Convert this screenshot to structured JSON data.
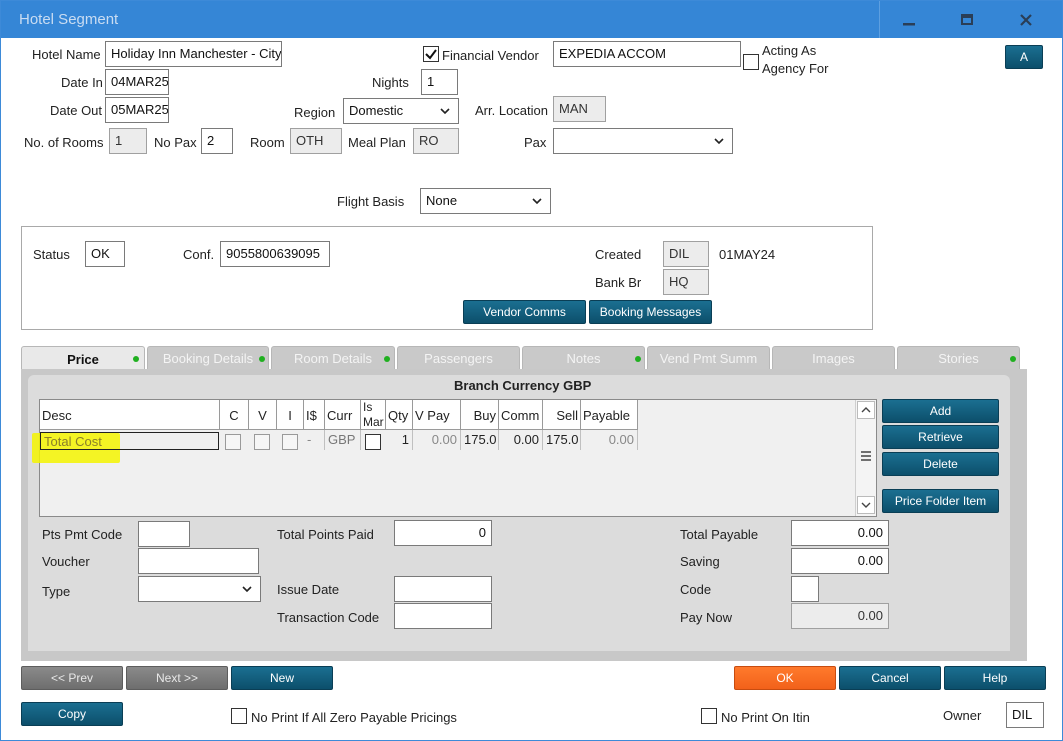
{
  "window": {
    "title": "Hotel Segment",
    "corner_button": "A"
  },
  "header": {
    "hotel_name_label": "Hotel Name",
    "hotel_name": "Holiday Inn Manchester - City",
    "financial_vendor_label": "Financial Vendor",
    "financial_vendor_checked": true,
    "vendor": "EXPEDIA ACCOM",
    "acting_as_label": "Acting As",
    "agency_for_label": "Agency For",
    "date_in_label": "Date In",
    "date_in": "04MAR25",
    "nights_label": "Nights",
    "nights": "1",
    "date_out_label": "Date Out",
    "date_out": "05MAR25",
    "region_label": "Region",
    "region": "Domestic",
    "arr_location_label": "Arr. Location",
    "arr_location": "MAN",
    "rooms_label": "No. of Rooms",
    "rooms": "1",
    "pax_count_label": "No Pax",
    "pax_count": "2",
    "room_label": "Room",
    "room": "OTH",
    "meal_plan_label": "Meal Plan",
    "meal_plan": "RO",
    "pax_label": "Pax",
    "pax": "",
    "flight_basis_label": "Flight Basis",
    "flight_basis": "None"
  },
  "status_box": {
    "status_label": "Status",
    "status": "OK",
    "conf_label": "Conf.",
    "conf": "9055800639095",
    "created_label": "Created",
    "created_by": "DIL",
    "created_date": "01MAY24",
    "bank_br_label": "Bank Br",
    "bank_br": "HQ",
    "vendor_comms": "Vendor Comms",
    "booking_messages": "Booking Messages"
  },
  "tabs": [
    {
      "label": "Price",
      "dot": true
    },
    {
      "label": "Booking Details",
      "dot": true
    },
    {
      "label": "Room Details",
      "dot": true
    },
    {
      "label": "Passengers",
      "dot": false
    },
    {
      "label": "Notes",
      "dot": true
    },
    {
      "label": "Vend Pmt Summ",
      "dot": false
    },
    {
      "label": "Images",
      "dot": false
    },
    {
      "label": "Stories",
      "dot": true
    }
  ],
  "price": {
    "heading": "Branch Currency GBP",
    "columns": [
      "Desc",
      "C",
      "V",
      "I",
      "I$",
      "Curr",
      "Is Mar",
      "Qty",
      "V Pay",
      "Buy",
      "Comm",
      "Sell",
      "Payable"
    ],
    "row": {
      "desc": "Total Cost",
      "i_dollar": "-",
      "curr": "GBP",
      "qty": "1",
      "v_pay": "0.00",
      "buy": "175.0",
      "comm": "0.00",
      "sell": "175.0",
      "payable": "0.00"
    },
    "buttons": {
      "add": "Add",
      "retrieve": "Retrieve",
      "delete": "Delete",
      "price_folder_item": "Price Folder Item"
    },
    "pts_pmt_code_label": "Pts Pmt Code",
    "voucher_label": "Voucher",
    "type_label": "Type",
    "total_points_paid_label": "Total Points Paid",
    "total_points_paid": "0",
    "issue_date_label": "Issue Date",
    "transaction_code_label": "Transaction Code",
    "total_payable_label": "Total Payable",
    "total_payable": "0.00",
    "saving_label": "Saving",
    "saving": "0.00",
    "code_label": "Code",
    "pay_now_label": "Pay Now",
    "pay_now": "0.00"
  },
  "footer": {
    "prev": "<< Prev",
    "next": "Next >>",
    "new": "New",
    "ok": "OK",
    "cancel": "Cancel",
    "help": "Help",
    "copy": "Copy",
    "no_print_zero_label": "No Print If All Zero Payable Pricings",
    "no_print_itin_label": "No Print On Itin",
    "owner_label": "Owner",
    "owner": "DIL"
  },
  "colors": {
    "titlebar": "#3586d6",
    "button": "#0f5a78",
    "ok_button": "#f2611a",
    "status_dot": "#20b020",
    "highlight": "#f5f500"
  }
}
